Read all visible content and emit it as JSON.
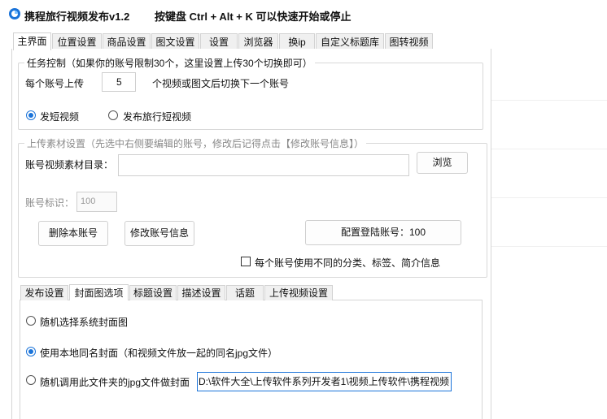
{
  "app": {
    "title": "携程旅行视频发布v1.2",
    "hint": "按键盘 Ctrl + Alt + K  可以快速开始或停止"
  },
  "main_tabs": [
    "主界面",
    "位置设置",
    "商品设置",
    "图文设置",
    "设置",
    "浏览器",
    "换ip",
    "自定义标题库",
    "图转视频"
  ],
  "task_control": {
    "legend": "任务控制（如果你的账号限制30个，这里设置上传30个切换即可）",
    "per_account_label": "每个账号上传",
    "per_account_value": "5",
    "per_account_suffix": "个视频或图文后切换下一个账号",
    "radio_short_video": "发短视频",
    "radio_travel_video": "发布旅行短视频"
  },
  "upload_material": {
    "legend": "上传素材设置（先选中右侧要编辑的账号，修改后记得点击【修改账号信息】）",
    "dir_label": "账号视频素材目录：",
    "dir_value": "",
    "browse_button": "浏览",
    "id_label": "账号标识：",
    "id_value": "100",
    "delete_button": "删除本账号",
    "modify_button": "修改账号信息",
    "config_button": "配置登陆账号：100",
    "checkbox_label": "每个账号使用不同的分类、标签、简介信息"
  },
  "sub_tabs": [
    "发布设置",
    "封面图选项",
    "标题设置",
    "描述设置",
    "话题",
    "上传视频设置"
  ],
  "cover_options": {
    "random_system": "随机选择系统封面图",
    "local_same_name": "使用本地同名封面（和视频文件放一起的同名jpg文件）",
    "random_folder": "随机调用此文件夹的jpg文件做封面",
    "folder_path": "D:\\软件大全\\上传软件系列开发者1\\视频上传软件\\携程视频"
  },
  "colors": {
    "accent": "#1a73d9",
    "border": "#d6d6d6",
    "tab_bg": "#f0f0f0"
  }
}
